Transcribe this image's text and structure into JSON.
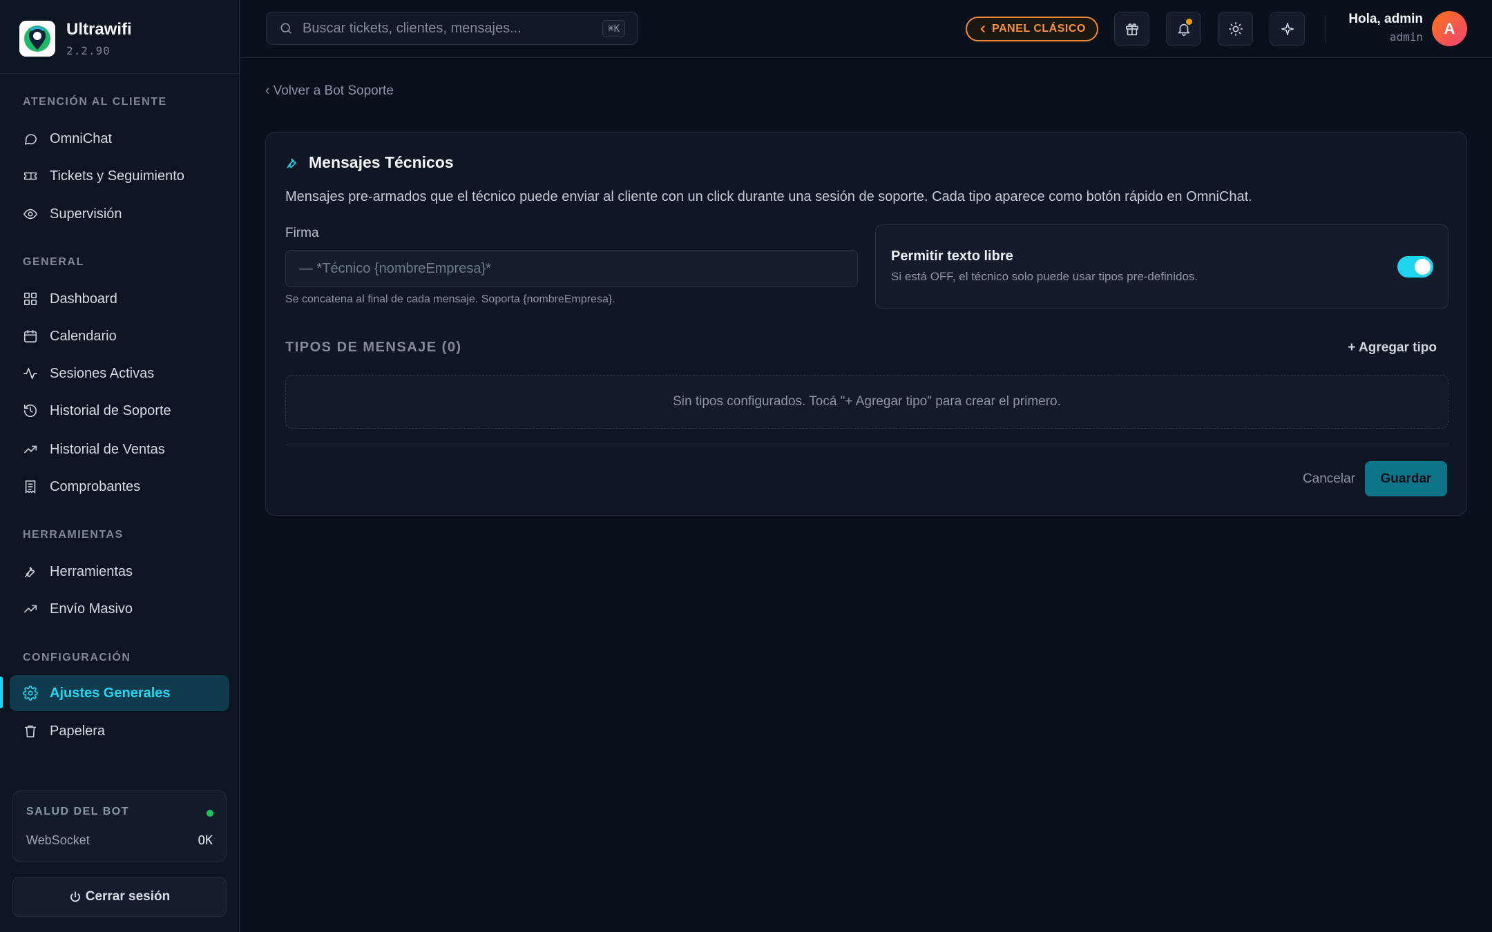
{
  "brand": {
    "name": "Ultrawifi",
    "version": "2.2.90"
  },
  "sidebar": {
    "sections": [
      {
        "title": "ATENCIÓN AL CLIENTE",
        "items": [
          "OmniChat",
          "Tickets y Seguimiento",
          "Supervisión"
        ]
      },
      {
        "title": "GENERAL",
        "items": [
          "Dashboard",
          "Calendario",
          "Sesiones Activas",
          "Historial de Soporte",
          "Historial de Ventas",
          "Comprobantes"
        ]
      },
      {
        "title": "HERRAMIENTAS",
        "items": [
          "Herramientas",
          "Envío Masivo"
        ]
      },
      {
        "title": "CONFIGURACIÓN",
        "items": [
          "Ajustes Generales",
          "Papelera"
        ]
      }
    ],
    "active_item": "Ajustes Generales",
    "health": {
      "title": "SALUD DEL BOT",
      "label": "WebSocket",
      "value": "OK",
      "status_color": "#22c55e"
    },
    "logout": "Cerrar sesión"
  },
  "topbar": {
    "search_placeholder": "Buscar tickets, clientes, mensajes...",
    "search_shortcut": "⌘K",
    "classic_panel": "PANEL CLÁSICO",
    "greeting": "Hola, admin",
    "role": "admin",
    "avatar_initial": "A",
    "icons": [
      "gift-icon",
      "bell-icon",
      "sun-icon",
      "sparkle-icon"
    ]
  },
  "main": {
    "back_link": "‹ Volver a Bot Soporte",
    "card": {
      "title": "Mensajes Técnicos",
      "description": "Mensajes pre-armados que el técnico puede enviar al cliente con un click durante una sesión de soporte. Cada tipo aparece como botón rápido en OmniChat.",
      "signature_label": "Firma",
      "signature_placeholder": "— *Técnico {nombreEmpresa}*",
      "signature_value": "",
      "signature_hint": "Se concatena al final de cada mensaje. Soporta {nombreEmpresa}.",
      "free_text_title": "Permitir texto libre",
      "free_text_sub": "Si está OFF, el técnico solo puede usar tipos pre-definidos.",
      "free_text_enabled": true,
      "types_title": "TIPOS DE MENSAJE (0)",
      "add_type": "+ Agregar tipo",
      "empty_text": "Sin tipos configurados. Tocá \"+ Agregar tipo\" para crear el primero.",
      "cancel": "Cancelar",
      "save": "Guardar"
    }
  },
  "colors": {
    "accent": "#22d3ee",
    "orange": "#f08a3a",
    "background": "#0b111c"
  }
}
